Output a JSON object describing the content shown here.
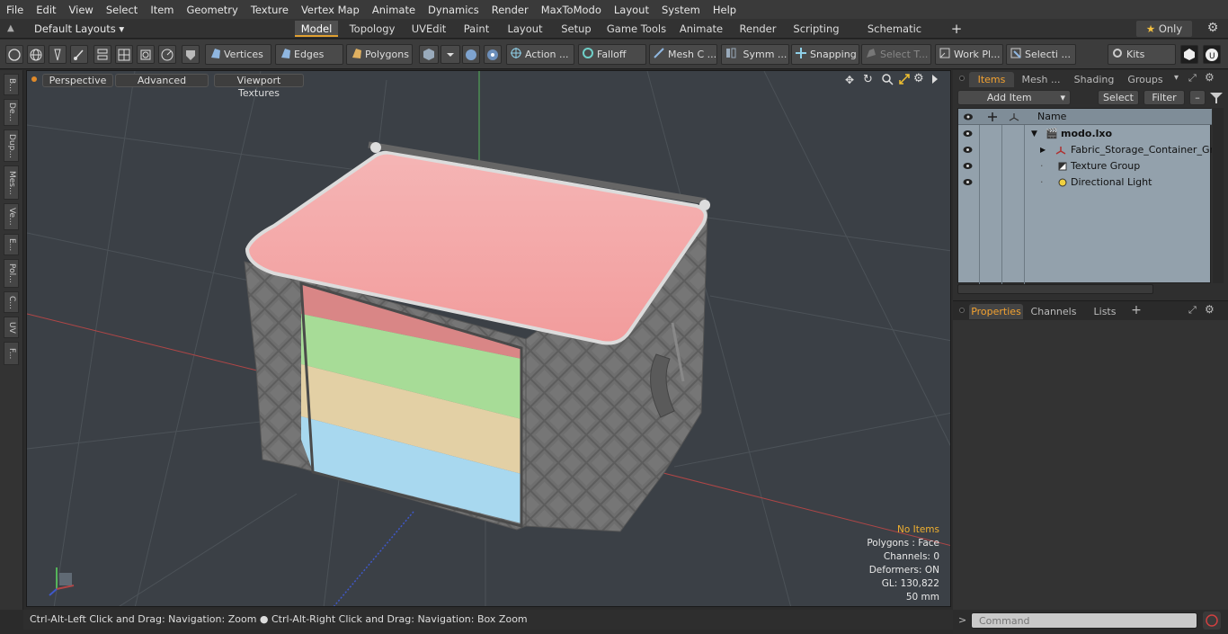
{
  "menu": [
    "File",
    "Edit",
    "View",
    "Select",
    "Item",
    "Geometry",
    "Texture",
    "Vertex Map",
    "Animate",
    "Dynamics",
    "Render",
    "MaxToModo",
    "Layout",
    "System",
    "Help"
  ],
  "layout_selector": "Default Layouts",
  "layout_tabs": [
    "Model",
    "Topology",
    "UVEdit",
    "Paint",
    "Layout",
    "Setup",
    "Game Tools",
    "Animate",
    "Render",
    "Scripting",
    "Schematic Fusion"
  ],
  "active_layout_tab": "Model",
  "only_label": "Only",
  "toolbar": {
    "vertices": "Vertices",
    "edges": "Edges",
    "polygons": "Polygons",
    "action": "Action ...",
    "falloff": "Falloff",
    "mesh": "Mesh C ...",
    "symmetry": "Symm ...",
    "snapping": "Snapping",
    "select_t": "Select T...",
    "workplane": "Work Pl...",
    "selection": "Selecti ...",
    "kits": "Kits"
  },
  "left_tabs": [
    "B...",
    "De...",
    "Dup...",
    "Mes...",
    "Ve...",
    "E...",
    "Pol...",
    "C...",
    "UV",
    "F..."
  ],
  "viewport": {
    "view_mode": "Perspective",
    "advanced": "Advanced",
    "textures": "Viewport Textures",
    "info": {
      "selection": "No Items",
      "polygons": "Polygons : Face",
      "channels": "Channels: 0",
      "deformers": "Deformers: ON",
      "gl": "GL: 130,822",
      "scale": "50 mm"
    }
  },
  "status": "Ctrl-Alt-Left Click and Drag: Navigation: Zoom ● Ctrl-Alt-Right Click and Drag: Navigation: Box Zoom",
  "right_panel": {
    "tabs": [
      "Items",
      "Mesh ...",
      "Shading",
      "Groups"
    ],
    "add_item": "Add Item",
    "select": "Select",
    "filter": "Filter",
    "column_name": "Name",
    "items": [
      {
        "name": "modo.lxo",
        "bold": true
      },
      {
        "name": "Fabric_Storage_Container_Gr...",
        "bold": false
      },
      {
        "name": "Texture Group",
        "bold": false
      },
      {
        "name": "Directional Light",
        "bold": false
      }
    ],
    "lower_tabs": [
      "Properties",
      "Channels",
      "Lists"
    ],
    "command_placeholder": "Command"
  },
  "colors": {
    "accent": "#f3a230",
    "lid": "#f7a9a9",
    "stripe1": "#d98686",
    "stripe2": "#a7dc97",
    "stripe3": "#e3d0a5",
    "stripe4": "#a8d8ef"
  }
}
